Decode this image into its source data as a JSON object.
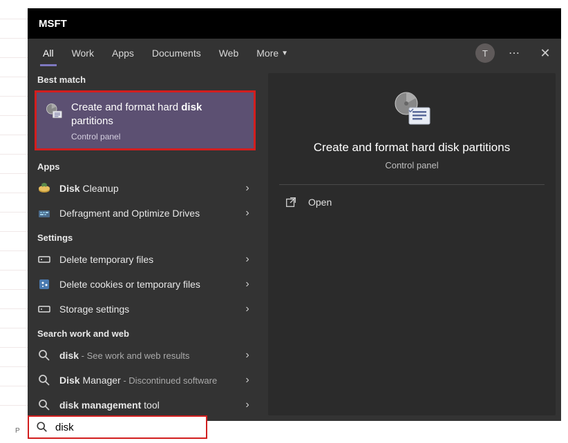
{
  "titlebar": {
    "title": "MSFT"
  },
  "tabs": {
    "items": [
      "All",
      "Work",
      "Apps",
      "Documents",
      "Web",
      "More"
    ],
    "active_index": 0
  },
  "avatar_initial": "T",
  "sections": {
    "best_match_hdr": "Best match",
    "apps_hdr": "Apps",
    "settings_hdr": "Settings",
    "work_web_hdr": "Search work and web"
  },
  "best_match": {
    "title_pre": "Create and format hard ",
    "title_bold": "disk",
    "title_post": " partitions",
    "subtitle": "Control panel"
  },
  "apps": [
    {
      "label_bold": "Disk",
      "label_post": " Cleanup",
      "icon": "disk-cleanup"
    },
    {
      "label_pre": "Defragment and Optimize Drives",
      "icon": "defrag"
    }
  ],
  "settings": [
    {
      "label": "Delete temporary files",
      "icon": "storage"
    },
    {
      "label": "Delete cookies or temporary files",
      "icon": "cookies"
    },
    {
      "label": "Storage settings",
      "icon": "storage"
    }
  ],
  "work_web": [
    {
      "bold": "disk",
      "muted": " - See work and web results"
    },
    {
      "bold": "Disk",
      "post": " Manager",
      "muted": " - Discontinued software"
    },
    {
      "bold": "disk",
      "post2_bold": " management",
      "post3": " tool"
    }
  ],
  "detail": {
    "title": "Create and format hard disk partitions",
    "subtitle": "Control panel",
    "open_label": "Open"
  },
  "search": {
    "value": "disk"
  },
  "page_label": "P"
}
